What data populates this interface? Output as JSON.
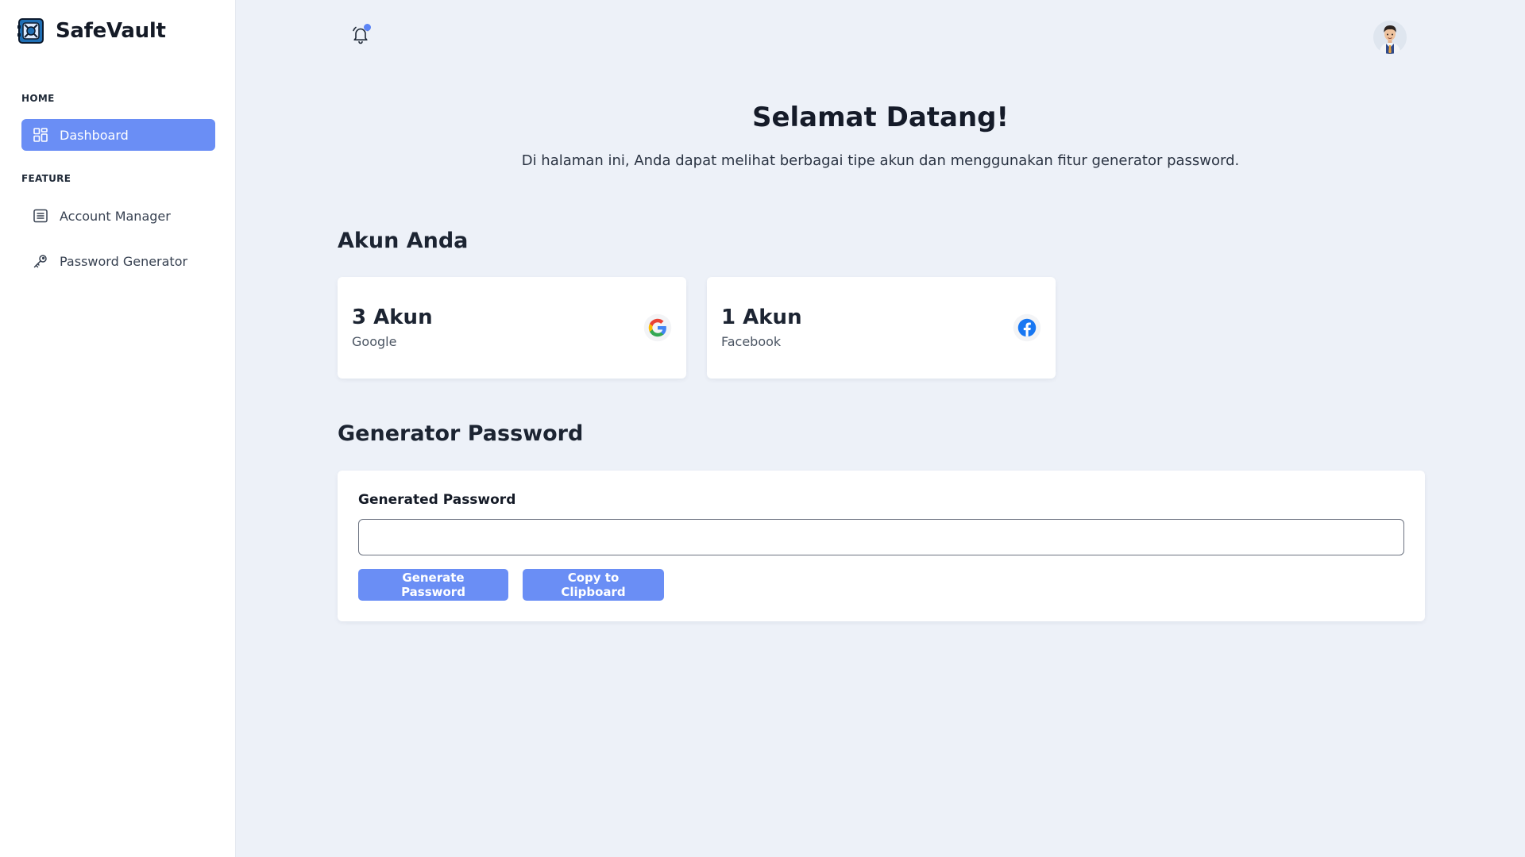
{
  "app": {
    "name": "SafeVault"
  },
  "sidebar": {
    "sections": [
      {
        "label": "HOME"
      },
      {
        "label": "FEATURE"
      }
    ],
    "items": [
      {
        "label": "Dashboard",
        "icon": "dashboard-grid-icon",
        "active": true
      },
      {
        "label": "Account Manager",
        "icon": "list-icon",
        "active": false
      },
      {
        "label": "Password Generator",
        "icon": "key-icon",
        "active": false
      }
    ]
  },
  "header": {
    "notification_icon": "bell-icon",
    "has_unread": true,
    "avatar_icon": "user-avatar"
  },
  "welcome": {
    "title": "Selamat Datang!",
    "subtitle": "Di halaman ini, Anda dapat melihat berbagai tipe akun dan menggunakan fitur generator password."
  },
  "accounts": {
    "title": "Akun Anda",
    "cards": [
      {
        "count": "3 Akun",
        "label": "Google",
        "icon": "google-icon"
      },
      {
        "count": "1 Akun",
        "label": "Facebook",
        "icon": "facebook-icon"
      }
    ]
  },
  "generator": {
    "title": "Generator Password",
    "field_label": "Generated Password",
    "value": "",
    "generate_label": "Generate Password",
    "copy_label": "Copy to Clipboard"
  },
  "colors": {
    "accent": "#6a8ef5",
    "background": "#edf1f8",
    "sidebar": "#ffffff",
    "facebook": "#1877f2"
  }
}
